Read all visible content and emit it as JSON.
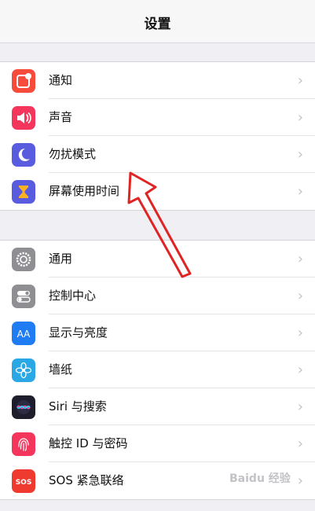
{
  "header": {
    "title": "设置"
  },
  "groups": [
    {
      "items": [
        {
          "label": "通知",
          "icon": "notifications-icon",
          "color": "#f74c3c"
        },
        {
          "label": "声音",
          "icon": "sounds-icon",
          "color": "#f5365c"
        },
        {
          "label": "勿扰模式",
          "icon": "do-not-disturb-moon-icon",
          "color": "#5a5ce0"
        },
        {
          "label": "屏幕使用时间",
          "icon": "screen-time-hourglass-icon",
          "color": "#5a5ce0"
        }
      ]
    },
    {
      "items": [
        {
          "label": "通用",
          "icon": "general-gear-icon",
          "color": "#8e8e93"
        },
        {
          "label": "控制中心",
          "icon": "control-center-icon",
          "color": "#8e8e93"
        },
        {
          "label": "显示与亮度",
          "icon": "display-brightness-icon",
          "color": "#1f7cf2"
        },
        {
          "label": "墙纸",
          "icon": "wallpaper-icon",
          "color": "#2aa8e6"
        },
        {
          "label": "Siri 与搜索",
          "icon": "siri-icon",
          "color": "#222233"
        },
        {
          "label": "触控 ID 与密码",
          "icon": "touch-id-fingerprint-icon",
          "color": "#f5365c"
        },
        {
          "label": "SOS 紧急联络",
          "icon": "emergency-sos-icon",
          "color": "#ef3b2f",
          "icon_text": "SOS"
        }
      ]
    }
  ],
  "chevron": "›",
  "annotation": {
    "icon": "red-pointer-arrow-icon",
    "color": "#e02424"
  },
  "watermark": "Baidu 经验"
}
